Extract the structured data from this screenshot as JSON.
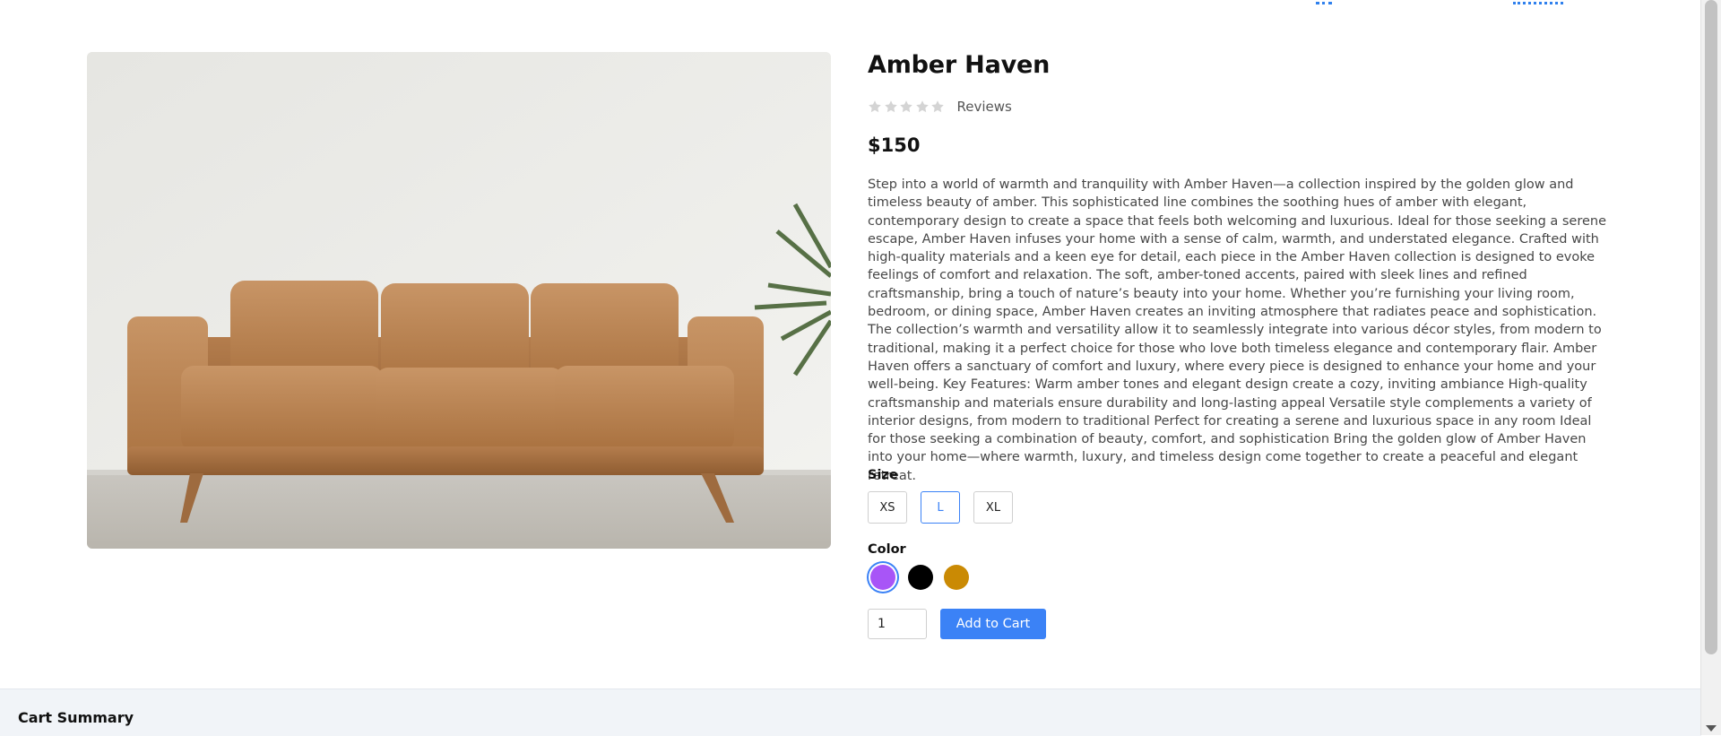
{
  "product": {
    "title": "Amber Haven",
    "reviews_label": "Reviews",
    "rating": 0,
    "rating_max": 5,
    "price": "$150",
    "description": "Step into a world of warmth and tranquility with Amber Haven—a collection inspired by the golden glow and timeless beauty of amber. This sophisticated line combines the soothing hues of amber with elegant, contemporary design to create a space that feels both welcoming and luxurious. Ideal for those seeking a serene escape, Amber Haven infuses your home with a sense of calm, warmth, and understated elegance. Crafted with high-quality materials and a keen eye for detail, each piece in the Amber Haven collection is designed to evoke feelings of comfort and relaxation. The soft, amber-toned accents, paired with sleek lines and refined craftsmanship, bring a touch of nature’s beauty into your home. Whether you’re furnishing your living room, bedroom, or dining space, Amber Haven creates an inviting atmosphere that radiates peace and sophistication. The collection’s warmth and versatility allow it to seamlessly integrate into various décor styles, from modern to traditional, making it a perfect choice for those who love both timeless elegance and contemporary flair. Amber Haven offers a sanctuary of comfort and luxury, where every piece is designed to enhance your home and your well-being. Key Features: Warm amber tones and elegant design create a cozy, inviting ambiance High-quality craftsmanship and materials ensure durability and long-lasting appeal Versatile style complements a variety of interior designs, from modern to traditional Perfect for creating a serene and luxurious space in any room Ideal for those seeking a combination of beauty, comfort, and sophistication Bring the golden glow of Amber Haven into your home—where warmth, luxury, and timeless design come together to create a peaceful and elegant retreat.",
    "size_label": "Size",
    "sizes": [
      "XS",
      "L",
      "XL"
    ],
    "selected_size": "L",
    "color_label": "Color",
    "colors": [
      "#a855f7",
      "#000000",
      "#ca8a04"
    ],
    "selected_color": "#a855f7",
    "quantity": "1",
    "add_to_cart_label": "Add to Cart"
  },
  "cart_summary": {
    "title": "Cart Summary"
  },
  "icons": {
    "star": "star-icon",
    "scroll_down": "chevron-down-icon"
  }
}
